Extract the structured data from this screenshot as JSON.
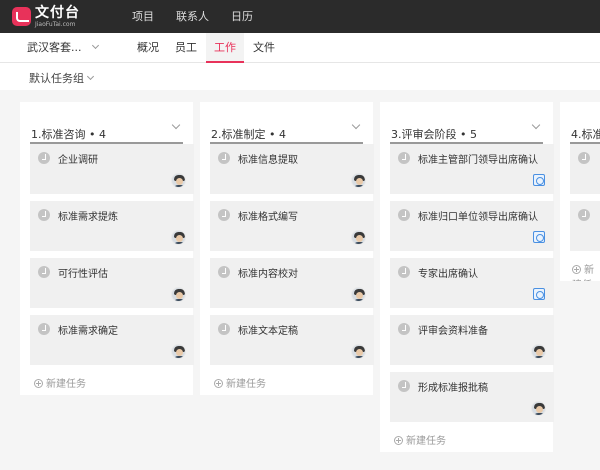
{
  "app": {
    "logo_name": "文付台",
    "logo_sub": "JiaoFuTai.com",
    "nav": [
      "项目",
      "联系人",
      "日历"
    ]
  },
  "project": {
    "name": "武汉客套...",
    "tabs": [
      "概况",
      "员工",
      "工作",
      "文件"
    ],
    "active_tab": "工作"
  },
  "task_group": "默认任务组",
  "new_task_label": "新建任务",
  "colors": {
    "accent": "#e8325a",
    "topbar": "#2b2b2b"
  },
  "columns": [
    {
      "title": "1.标准咨询 • 4",
      "cards": [
        {
          "title": "企业调研",
          "icon": "avatar"
        },
        {
          "title": "标准需求提炼",
          "icon": "avatar"
        },
        {
          "title": "可行性评估",
          "icon": "avatar"
        },
        {
          "title": "标准需求确定",
          "icon": "avatar"
        }
      ]
    },
    {
      "title": "2.标准制定 • 4",
      "cards": [
        {
          "title": "标准信息提取",
          "icon": "avatar"
        },
        {
          "title": "标准格式编写",
          "icon": "avatar"
        },
        {
          "title": "标准内容校对",
          "icon": "avatar"
        },
        {
          "title": "标准文本定稿",
          "icon": "avatar"
        }
      ]
    },
    {
      "title": "3.评审会阶段 • 5",
      "cards": [
        {
          "title": "标准主管部门领导出席确认",
          "icon": "badge-icon"
        },
        {
          "title": "标准归口单位领导出席确认",
          "icon": "badge-icon"
        },
        {
          "title": "专家出席确认",
          "icon": "badge-icon"
        },
        {
          "title": "评审会资料准备",
          "icon": "avatar"
        },
        {
          "title": "形成标准报批稿",
          "icon": "avatar"
        }
      ]
    },
    {
      "title": "4.标准"
    }
  ]
}
